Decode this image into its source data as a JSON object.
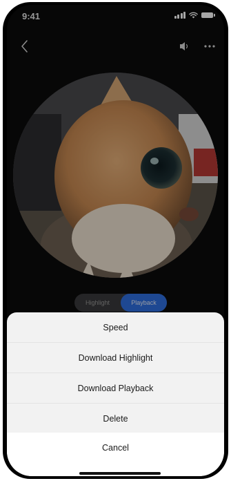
{
  "status_bar": {
    "time": "9:41"
  },
  "nav": {
    "back_icon": "chevron-left-icon",
    "speaker_icon": "speaker-icon",
    "more_icon": "more-dots-icon"
  },
  "video": {
    "content": "cat-video-frame"
  },
  "tabs": [
    {
      "label": "Highlight",
      "active": false
    },
    {
      "label": "Playback",
      "active": true
    }
  ],
  "action_sheet": {
    "items": [
      {
        "label": "Speed"
      },
      {
        "label": "Download Highlight"
      },
      {
        "label": "Download Playback"
      },
      {
        "label": "Delete"
      }
    ],
    "cancel_label": "Cancel"
  },
  "colors": {
    "accent": "#2f6fe0",
    "sheet_bg": "#f2f2f2",
    "screen_bg": "#0b0b0b"
  }
}
